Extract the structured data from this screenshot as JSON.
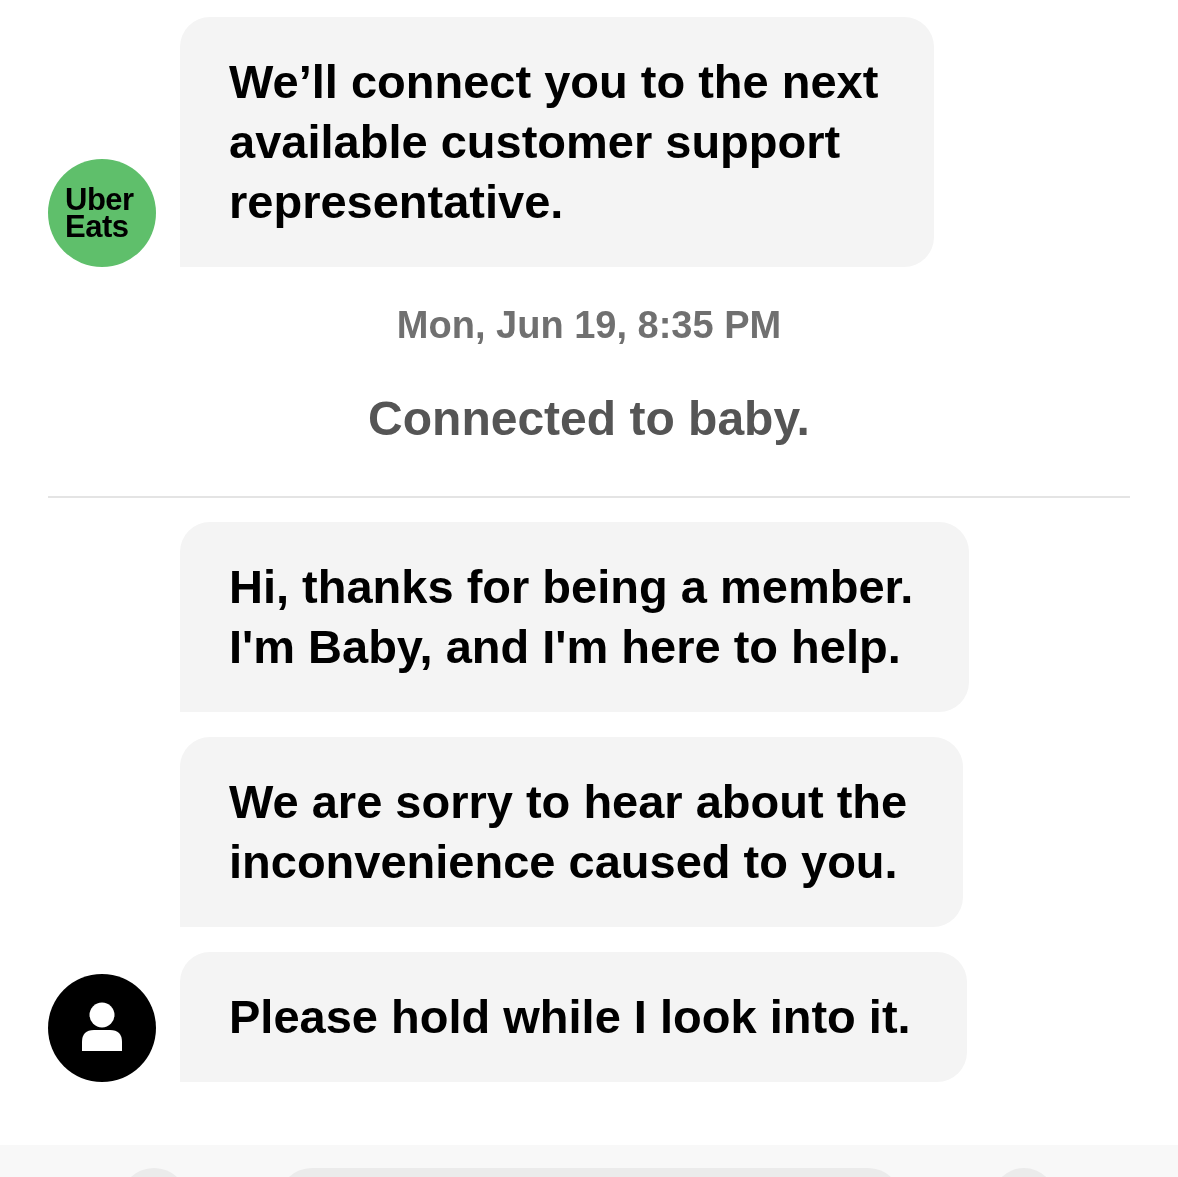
{
  "chat": [
    {
      "kind": "group",
      "avatar": {
        "kind": "logo",
        "text": "Uber Eats"
      },
      "messages": [
        "We’ll connect you to the next\navailable customer support\nrepresentative."
      ]
    },
    {
      "kind": "timestamp",
      "text": "Mon, Jun 19, 8:35 PM"
    },
    {
      "kind": "notice",
      "text": "Connected to baby."
    },
    {
      "kind": "divider"
    },
    {
      "kind": "group",
      "avatar": {
        "kind": "person"
      },
      "messages": [
        "Hi, thanks for being a member.\nI'm Baby, and I'm here to help.",
        "We are sorry to hear about the\ninconvenience caused to you.",
        "Please hold while I look into it."
      ]
    }
  ]
}
